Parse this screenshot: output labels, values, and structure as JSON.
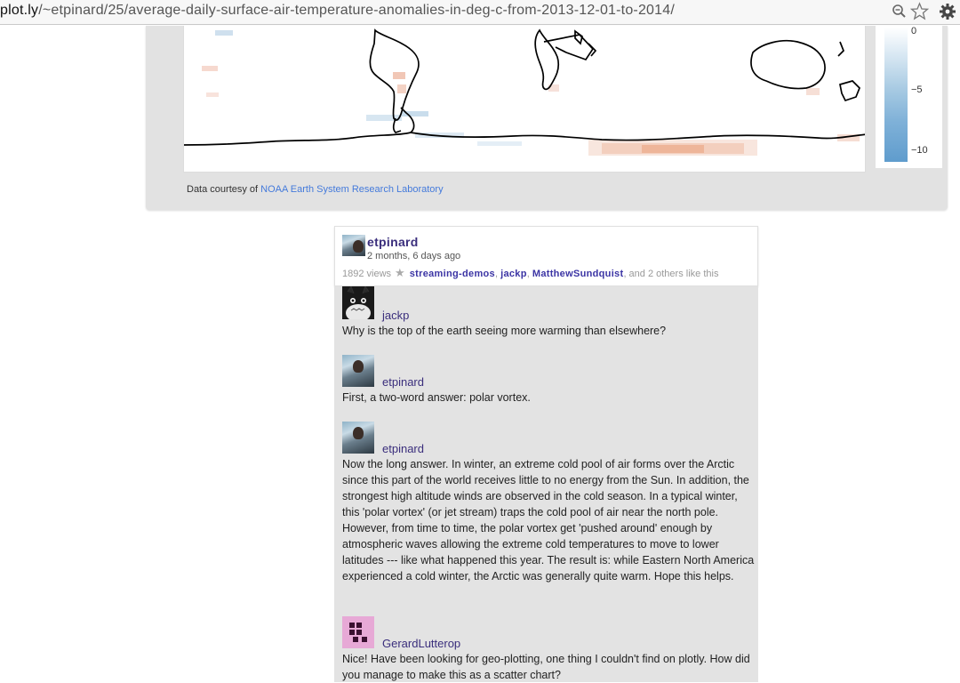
{
  "browser": {
    "url_host": "plot.ly",
    "url_path": "/~etpinard/25/average-daily-surface-air-temperature-anomalies-in-deg-c-from-2013-12-01-to-2014/"
  },
  "plot": {
    "colorbar_ticks": [
      "0",
      "−5",
      "−10"
    ],
    "credit_prefix": "Data courtesy of ",
    "credit_link": "NOAA Earth System Research Laboratory"
  },
  "post": {
    "owner": "etpinard",
    "time_ago": "2 months, 6 days ago",
    "views": "1892 views",
    "likers": [
      "streaming-demos",
      "jackp",
      "MatthewSundquist"
    ],
    "likes_suffix": ", and 2 others like this"
  },
  "comments": [
    {
      "author": "jackp",
      "text": "Why is the top of the earth seeing more warming than elsewhere?"
    },
    {
      "author": "etpinard",
      "text": "First, a two-word answer: polar vortex."
    },
    {
      "author": "etpinard",
      "text": "Now the long answer. In winter, an extreme cold pool of air forms over the Arctic since this part of the world receives little to no energy from the Sun. In addition, the strongest high altitude winds are observed in the cold season. In a typical winter, this 'polar vortex' (or jet stream) traps the cold pool of air near the north pole. However, from time to time, the polar vortex get 'pushed around' enough by atmospheric waves allowing the extreme cold temperatures to move to lower latitudes --- like what happened this year. The result is: while Eastern North America experienced a cold winter, the Arctic was generally quite warm. Hope this helps."
    },
    {
      "author": "GerardLutterop",
      "text": "Nice! Have been looking for geo-plotting, one thing I couldn't find on plotly. How did you manage to make this as a scatter chart?"
    }
  ]
}
